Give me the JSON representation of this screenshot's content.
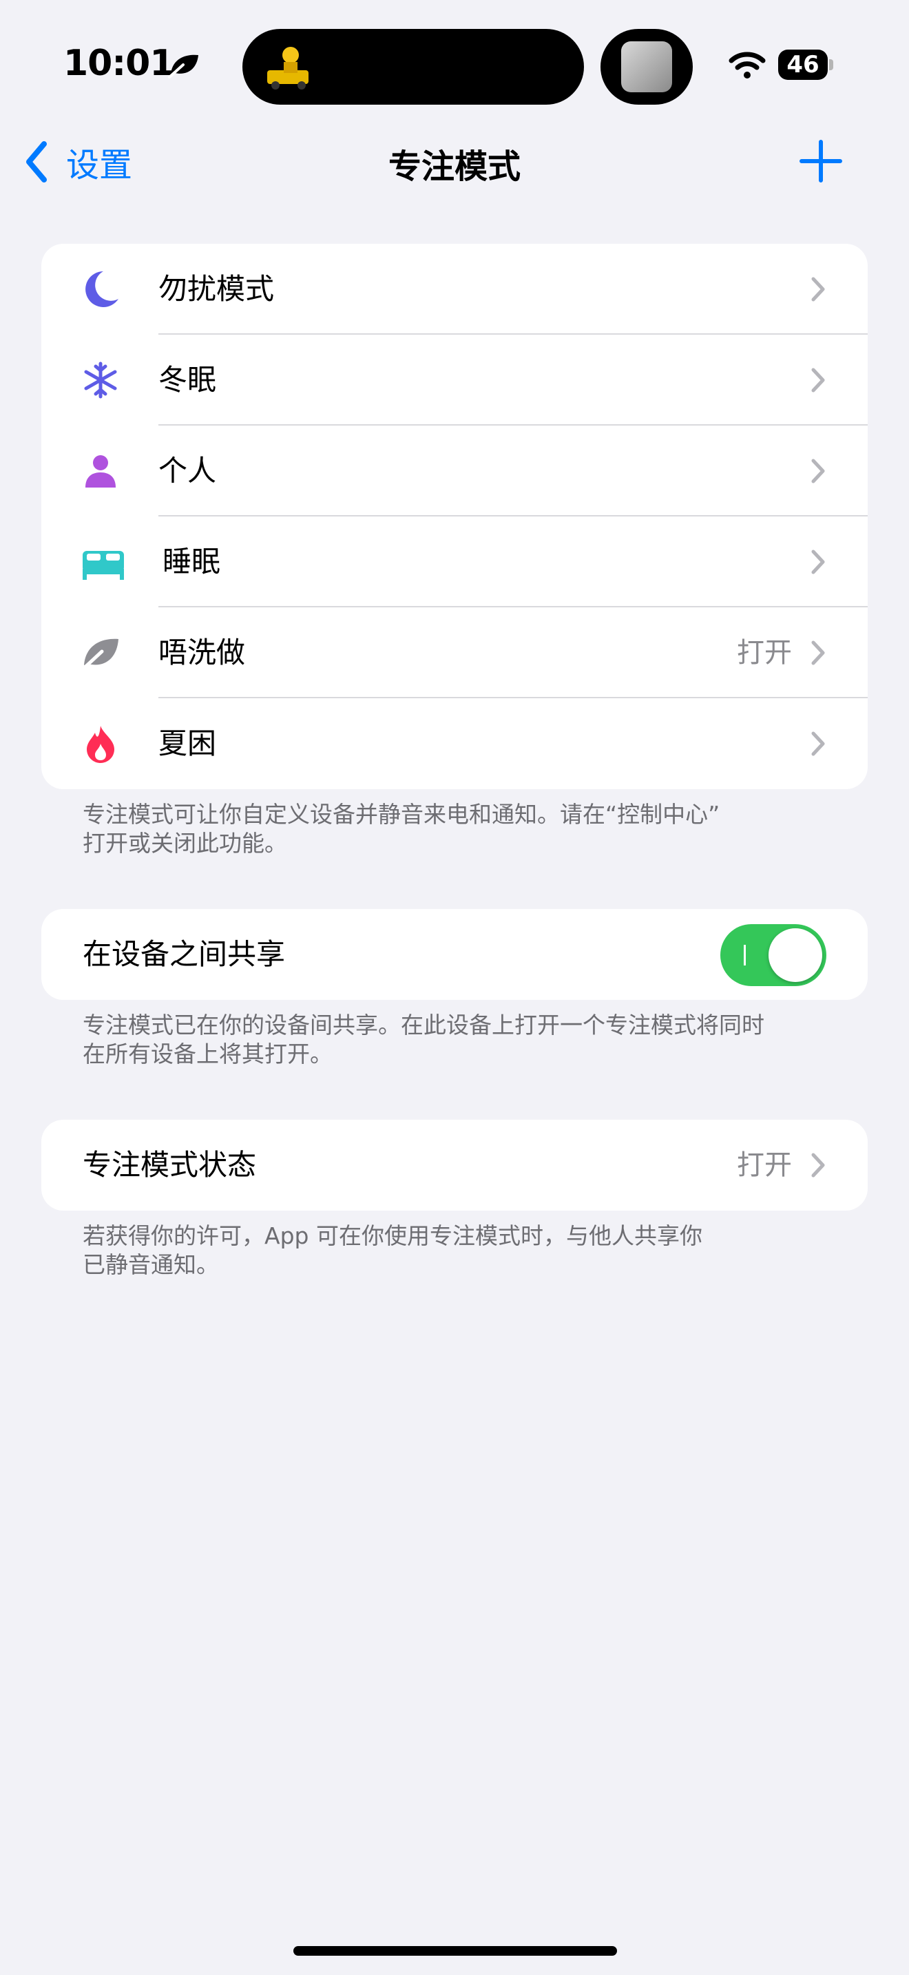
{
  "status_bar": {
    "time": "10:01",
    "battery": "46",
    "focus_icon": "leaf-icon",
    "wifi_icon": "wifi-icon"
  },
  "nav": {
    "back_label": "设置",
    "title": "专注模式",
    "add_icon": "plus-icon"
  },
  "focus_modes": [
    {
      "label": "勿扰模式",
      "icon": "moon-icon",
      "color": "#5E5CE6",
      "value": ""
    },
    {
      "label": "冬眠",
      "icon": "snowflake-icon",
      "color": "#5E5CE6",
      "value": ""
    },
    {
      "label": "个人",
      "icon": "person-icon",
      "color": "#AF52DE",
      "value": ""
    },
    {
      "label": "睡眠",
      "icon": "bed-icon",
      "color": "#30C8C9",
      "value": ""
    },
    {
      "label": "唔洗做",
      "icon": "leaf-icon",
      "color": "#8E8E93",
      "value": "打开"
    },
    {
      "label": "夏困",
      "icon": "flame-icon",
      "color": "#FF2D55",
      "value": ""
    }
  ],
  "focus_footnote": [
    "专注模式可让你自定义设备并静音来电和通知。请在“控制中心”",
    "打开或关闭此功能。"
  ],
  "share": {
    "label": "在设备之间共享",
    "enabled": true,
    "footnote": [
      "专注模式已在你的设备间共享。在此设备上打开一个专注模式将同时",
      "在所有设备上将其打开。"
    ]
  },
  "status": {
    "label": "专注模式状态",
    "value": "打开",
    "footnote": [
      "若获得你的许可，App 可在你使用专注模式时，与他人共享你",
      "已静音通知。"
    ]
  },
  "colors": {
    "accent": "#007AFF",
    "toggle_on": "#34C759",
    "background": "#F2F2F7"
  }
}
